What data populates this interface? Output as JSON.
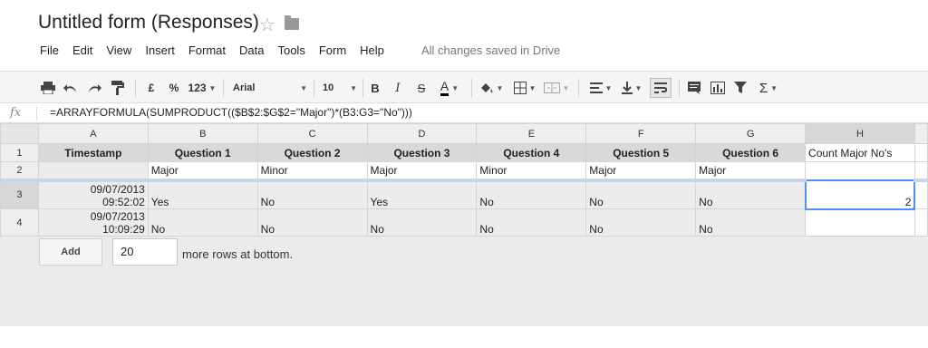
{
  "title": "Untitled form (Responses)",
  "menu": [
    "File",
    "Edit",
    "View",
    "Insert",
    "Format",
    "Data",
    "Tools",
    "Form",
    "Help"
  ],
  "save_status": "All changes saved in Drive",
  "toolbar": {
    "currency": "£",
    "percent": "%",
    "number_format": "123",
    "font": "Arial",
    "font_size": "10",
    "bold": "B",
    "italic": "I",
    "strike": "S",
    "text_color": "A",
    "functions": "Σ"
  },
  "formula_bar": {
    "fx": "fx",
    "formula": "=ARRAYFORMULA(SUMPRODUCT(($B$2:$G$2=\"Major\")*(B3:G3=\"No\")))"
  },
  "sheet": {
    "columns": [
      "A",
      "B",
      "C",
      "D",
      "E",
      "F",
      "G",
      "H"
    ],
    "row_numbers": [
      "1",
      "2",
      "3",
      "4"
    ],
    "headers": [
      "Timestamp",
      "Question 1",
      "Question 2",
      "Question 3",
      "Question 4",
      "Question 5",
      "Question 6",
      "Count Major No's"
    ],
    "row2": [
      "",
      "Major",
      "Minor",
      "Major",
      "Minor",
      "Major",
      "Major",
      ""
    ],
    "row3": {
      "date": "09/07/2013",
      "time": "09:52:02",
      "answers": [
        "Yes",
        "No",
        "Yes",
        "No",
        "No",
        "No"
      ],
      "count": "2"
    },
    "row4": {
      "date": "09/07/2013",
      "time": "10:09:29",
      "answers": [
        "No",
        "No",
        "No",
        "No",
        "No",
        "No"
      ],
      "count": ""
    }
  },
  "add_rows": {
    "button": "Add",
    "count": "20",
    "text": "more rows at bottom."
  }
}
